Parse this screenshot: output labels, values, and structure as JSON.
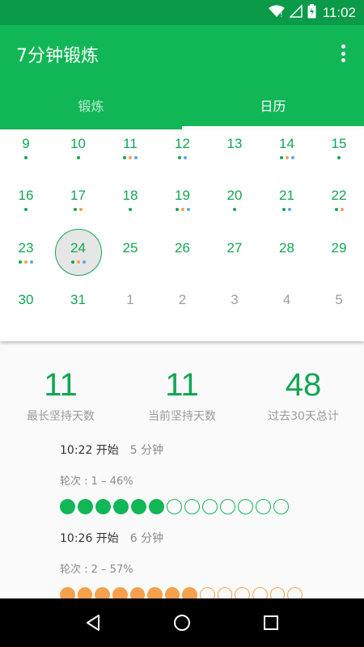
{
  "status": {
    "time": "11:02"
  },
  "app": {
    "title": "7分钟锻炼"
  },
  "tabs": [
    {
      "label": "锻炼",
      "active": false
    },
    {
      "label": "日历",
      "active": true
    }
  ],
  "colors": {
    "primary": "#11b656",
    "status_bar": "#0a9a48",
    "text_green": "#11a653",
    "dot_green": "#11a653",
    "dot_orange": "#f5a04c",
    "dot_blue": "#5aa9e6",
    "circle_green": "#11b656",
    "circle_orange": "#f5a04c"
  },
  "calendar": {
    "rows": [
      [
        {
          "d": "9",
          "dots": [
            "g"
          ]
        },
        {
          "d": "10",
          "dots": [
            "g"
          ]
        },
        {
          "d": "11",
          "dots": [
            "g",
            "o",
            "b"
          ]
        },
        {
          "d": "12",
          "dots": [
            "g",
            "b"
          ]
        },
        {
          "d": "13",
          "dots": []
        },
        {
          "d": "14",
          "dots": [
            "g",
            "o",
            "b"
          ]
        },
        {
          "d": "15",
          "dots": [
            "g"
          ]
        }
      ],
      [
        {
          "d": "16",
          "dots": [
            "g"
          ]
        },
        {
          "d": "17",
          "dots": [
            "g",
            "o"
          ]
        },
        {
          "d": "18",
          "dots": [
            "g"
          ]
        },
        {
          "d": "19",
          "dots": [
            "g",
            "o",
            "b"
          ]
        },
        {
          "d": "20",
          "dots": [
            "g"
          ]
        },
        {
          "d": "21",
          "dots": [
            "g",
            "b"
          ]
        },
        {
          "d": "22",
          "dots": [
            "g",
            "o"
          ]
        }
      ],
      [
        {
          "d": "23",
          "dots": [
            "g",
            "o",
            "b"
          ]
        },
        {
          "d": "24",
          "dots": [
            "g",
            "o",
            "b"
          ],
          "today": true
        },
        {
          "d": "25",
          "dots": []
        },
        {
          "d": "26",
          "dots": []
        },
        {
          "d": "27",
          "dots": []
        },
        {
          "d": "28",
          "dots": []
        },
        {
          "d": "29",
          "dots": []
        }
      ],
      [
        {
          "d": "30",
          "dots": []
        },
        {
          "d": "31",
          "dots": []
        },
        {
          "d": "1",
          "dots": [],
          "other": true
        },
        {
          "d": "2",
          "dots": [],
          "other": true
        },
        {
          "d": "3",
          "dots": [],
          "other": true
        },
        {
          "d": "4",
          "dots": [],
          "other": true
        },
        {
          "d": "5",
          "dots": [],
          "other": true
        }
      ]
    ]
  },
  "stats": [
    {
      "value": "11",
      "label": "最长坚持天数"
    },
    {
      "value": "11",
      "label": "当前坚持天数"
    },
    {
      "value": "48",
      "label": "过去30天总计"
    }
  ],
  "sessions": [
    {
      "start": "10:22 开始",
      "duration": "5 分钟",
      "round": "轮次 : 1 – 46%",
      "filled": 6,
      "total": 13,
      "color": "green"
    },
    {
      "start": "10:26 开始",
      "duration": "6 分钟",
      "round": "轮次 : 2 – 57%",
      "filled": 8,
      "total": 14,
      "color": "orange"
    }
  ]
}
